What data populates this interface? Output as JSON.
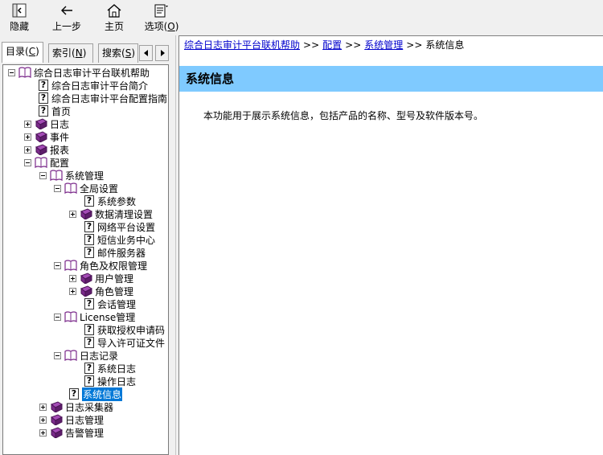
{
  "toolbar": {
    "hide": "隐藏",
    "back": "上一步",
    "home": "主页",
    "options": "选项",
    "options_key": "O"
  },
  "tabs": {
    "contents": "目录",
    "contents_key": "C",
    "index": "索引",
    "index_key": "N",
    "search": "搜索",
    "search_key": "S"
  },
  "tree": {
    "root": "综合日志审计平台联机帮助",
    "intro": "综合日志审计平台简介",
    "config_guide": "综合日志审计平台配置指南",
    "home": "首页",
    "log": "日志",
    "event": "事件",
    "report": "报表",
    "config": "配置",
    "sys_mgmt": "系统管理",
    "global_settings": "全局设置",
    "sys_params": "系统参数",
    "data_cleanup": "数据清理设置",
    "network_platform": "网络平台设置",
    "sms_center": "短信业务中心",
    "mail_server": "邮件服务器",
    "roles_perms": "角色及权限管理",
    "user_mgmt": "用户管理",
    "role_mgmt": "角色管理",
    "session_mgmt": "会话管理",
    "license_mgmt": "License管理",
    "get_license": "获取授权申请码",
    "import_license": "导入许可证文件",
    "log_records": "日志记录",
    "system_log": "系统日志",
    "operation_log": "操作日志",
    "system_info": "系统信息",
    "log_collector": "日志采集器",
    "log_mgmt": "日志管理",
    "alarm_mgmt": "告警管理"
  },
  "breadcrumb": {
    "root": "综合日志审计平台联机帮助",
    "config": "配置",
    "sys_mgmt": "系统管理",
    "current": "系统信息",
    "sep": ">>"
  },
  "content": {
    "title": "系统信息",
    "description": "本功能用于展示系统信息，包括产品的名称、型号及软件版本号。"
  },
  "colors": {
    "title_bar": "#7fcaff",
    "link": "#0000cc",
    "selected": "#0078d7",
    "book": "#7b2a8b"
  }
}
